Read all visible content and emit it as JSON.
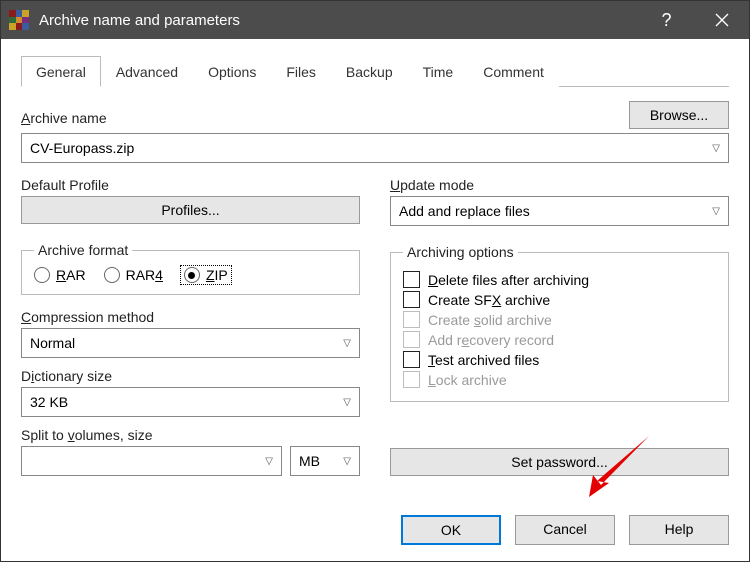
{
  "title": "Archive name and parameters",
  "tabs": [
    "General",
    "Advanced",
    "Options",
    "Files",
    "Backup",
    "Time",
    "Comment"
  ],
  "browse": "Browse...",
  "archive_name_label": "Archive name",
  "archive_name_value": "CV-Europass.zip",
  "default_profile_label": "Default Profile",
  "profiles_btn": "Profiles...",
  "archive_format_label": "Archive format",
  "fmt_rar": "RAR",
  "fmt_rar4": "RAR4",
  "fmt_zip": "ZIP",
  "compression_label": "Compression method",
  "compression_value": "Normal",
  "dict_label": "Dictionary size",
  "dict_value": "32 KB",
  "split_label": "Split to volumes, size",
  "split_value": "",
  "split_unit": "MB",
  "update_label": "Update mode",
  "update_value": "Add and replace files",
  "archopts_label": "Archiving options",
  "opt_delete": "Delete files after archiving",
  "opt_sfx": "Create SFX archive",
  "opt_solid": "Create solid archive",
  "opt_recovery": "Add recovery record",
  "opt_test": "Test archived files",
  "opt_lock": "Lock archive",
  "set_password": "Set password...",
  "ok": "OK",
  "cancel": "Cancel",
  "help": "Help"
}
